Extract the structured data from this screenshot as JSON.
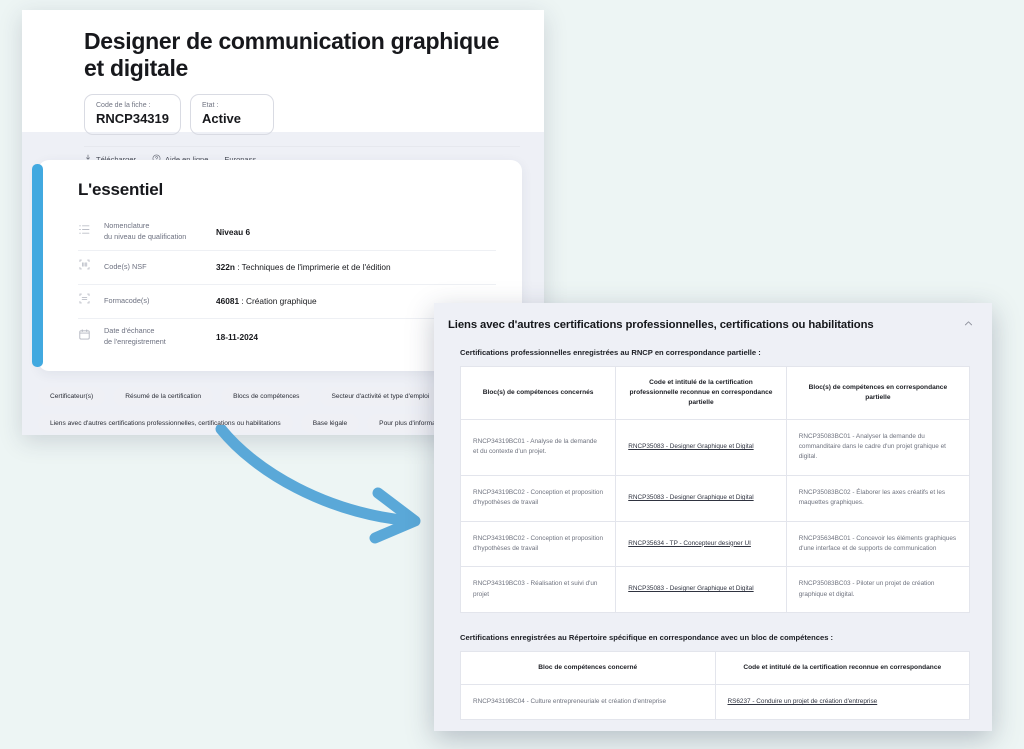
{
  "background_color": "#edf5f4",
  "accent_color": "#41a9e0",
  "arrow": {
    "icon": "curved-arrow-icon",
    "color": "#5aa8d8"
  },
  "left_window": {
    "header": {
      "title": "Designer de communication graphique et digitale",
      "code_boxes": [
        {
          "label": "Code de la fiche :",
          "value": "RNCP34319"
        },
        {
          "label": "Etat :",
          "value": "Active"
        }
      ],
      "links": [
        {
          "icon": "download-icon",
          "label": "Télécharger"
        },
        {
          "icon": "help-circle-icon",
          "label": "Aide en ligne"
        },
        {
          "icon": "",
          "label": "Europass"
        }
      ]
    },
    "essentiel": {
      "title": "L'essentiel",
      "rows": [
        {
          "icon": "list-icon",
          "label": "Nomenclature\ndu niveau de qualification",
          "label_line1": "Nomenclature",
          "label_line2": "du niveau de qualification",
          "value_bold": "Niveau 6",
          "value_rest": ""
        },
        {
          "icon": "nsf-code-icon",
          "label_line1": "Code(s) NSF",
          "label_line2": "",
          "value_bold": "322n",
          "value_rest": " : Techniques de l'imprimerie et de l'édition"
        },
        {
          "icon": "formacode-icon",
          "label_line1": "Formacode(s)",
          "label_line2": "",
          "value_bold": "46081",
          "value_rest": " : Création graphique"
        },
        {
          "icon": "calendar-icon",
          "label_line1": "Date d'échance",
          "label_line2": "de l'enregistrement",
          "value_bold": "18-11-2024",
          "value_rest": ""
        }
      ]
    },
    "chips": [
      "Certificateur(s)",
      "Résumé de la certification",
      "Blocs de compétences",
      "Secteur d'activité et type d'emploi",
      "Liens avec d'autres certifications professionnelles, certifications ou habilitations",
      "Base légale",
      "Pour plus d'informations"
    ]
  },
  "right_panel": {
    "title": "Liens avec d'autres certifications professionnelles, certifications ou habilitations",
    "collapse_icon": "chevron-up-icon",
    "section1": {
      "subtitle": "Certifications professionnelles enregistrées au RNCP en correspondance partielle :",
      "headers": [
        "Bloc(s) de compétences concernés",
        "Code et intitulé de la certification professionnelle reconnue en correspondance partielle",
        "Bloc(s) de compétences en correspondance partielle"
      ],
      "rows": [
        {
          "bloc": "RNCP34319BC01 - Analyse de la demande et du contexte d'un projet.",
          "certification": "RNCP35083 - Designer Graphique et Digital",
          "correspondance": "RNCP35083BC01 - Analyser la demande du commanditaire dans le cadre d'un projet grahique et digital."
        },
        {
          "bloc": "RNCP34319BC02 - Conception et proposition d'hypothèses de travail",
          "certification": "RNCP35083 - Designer Graphique et Digital",
          "correspondance": "RNCP35083BC02 - Élaborer les axes créatifs et les maquettes graphiques."
        },
        {
          "bloc": "RNCP34319BC02 - Conception et proposition d'hypothèses de travail",
          "certification": "RNCP35634 - TP - Concepteur designer UI",
          "correspondance": "RNCP35634BC01 - Concevoir les éléments graphiques d'une interface et de supports de communication"
        },
        {
          "bloc": "RNCP34319BC03 - Réalisation et suivi d'un projet",
          "certification": "RNCP35083 - Designer Graphique et Digital",
          "correspondance": "RNCP35083BC03 - Piloter un projet de création graphique et digital."
        }
      ]
    },
    "section2": {
      "subtitle": "Certifications enregistrées au Répertoire spécifique en correspondance avec un bloc de compétences :",
      "headers": [
        "Bloc de compétences concerné",
        "Code et intitulé de la certification reconnue en correspondance"
      ],
      "rows": [
        {
          "bloc": "RNCP34319BC04 - Culture entrepreneuriale et création d'entreprise",
          "certification": "RS6237 - Conduire un projet de création d'entreprise"
        }
      ]
    }
  }
}
